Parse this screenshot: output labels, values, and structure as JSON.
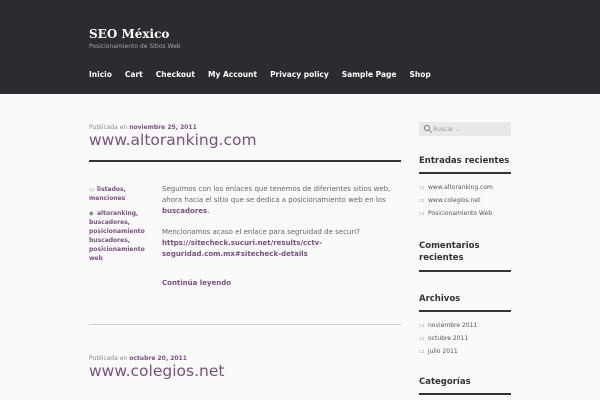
{
  "site": {
    "title": "SEO México",
    "tagline": "Posicionamiento de Sitios Web"
  },
  "nav": [
    "Inicio",
    "Cart",
    "Checkout",
    "My Account",
    "Privacy policy",
    "Sample Page",
    "Shop"
  ],
  "posts": [
    {
      "meta_prefix": "Publicada en",
      "date": "noviembre 25, 2011",
      "title": "www.altoranking.com",
      "categories": [
        "listados",
        "menciones"
      ],
      "tags": [
        "altoranking",
        "buscadores",
        "posicionamiento buscadores",
        "posicionamiento web"
      ],
      "paragraph1_text": "Seguimos con los enlaces que tenemos de diferientes sitios web, ahora hacia el sitio que se dedica a posicionamiento web en los",
      "paragraph1_link": "buscadores",
      "paragraph2_text": "Mencionamos acaso el enlace para segruidad de securi?",
      "paragraph2_link": "https://sitecheck.sucuri.net/results/cctv-seguridad.com.mx#sitecheck-details",
      "more": "Continúa leyendo"
    },
    {
      "meta_prefix": "Publicada en",
      "date": "octubre 20, 2011",
      "title": "www.colegios.net"
    }
  ],
  "sidebar": {
    "search_placeholder": "Buscar ...",
    "recent_title": "Entradas recientes",
    "recent": [
      "www.altoranking.com",
      "www.colegios.net",
      "Posicionamiento Web"
    ],
    "comments_title": "Comentarios recientes",
    "archives_title": "Archivos",
    "archives": [
      "noviembre 2011",
      "octubre 2011",
      "julio 2011"
    ],
    "categories_title": "Categorías"
  }
}
